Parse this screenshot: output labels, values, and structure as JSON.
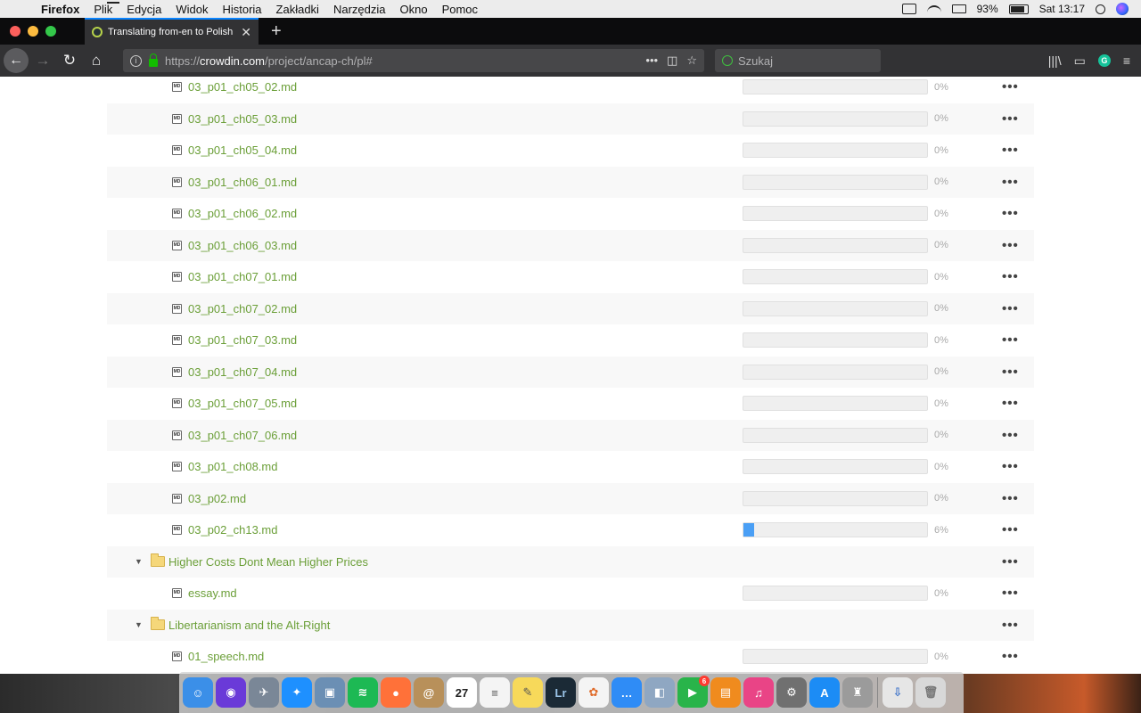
{
  "menubar": {
    "app": "Firefox",
    "items": [
      "Plik",
      "Edycja",
      "Widok",
      "Historia",
      "Zakładki",
      "Narzędzia",
      "Okno",
      "Pomoc"
    ],
    "battery": "93%",
    "clock": "Sat 13:17"
  },
  "tabs": [
    {
      "title": "Translating from-en to Polish la"
    }
  ],
  "navbar": {
    "url_prefix": "https://",
    "url_host": "crowdin.com",
    "url_path": "/project/ancap-ch/pl#",
    "search_placeholder": "Szukaj",
    "icons": [
      "back-icon",
      "forward-icon",
      "reload-icon",
      "home-icon",
      "info-icon",
      "lock-icon",
      "page-actions-icon",
      "pocket-icon",
      "bookmark-star-icon",
      "library-icon",
      "sidebar-icon",
      "grammarly-icon",
      "menu-icon"
    ]
  },
  "rows": [
    {
      "type": "file",
      "name": "03_p01_ch05_02.md",
      "progress": 0,
      "pct": "0%"
    },
    {
      "type": "file",
      "name": "03_p01_ch05_03.md",
      "progress": 0,
      "pct": "0%"
    },
    {
      "type": "file",
      "name": "03_p01_ch05_04.md",
      "progress": 0,
      "pct": "0%"
    },
    {
      "type": "file",
      "name": "03_p01_ch06_01.md",
      "progress": 0,
      "pct": "0%"
    },
    {
      "type": "file",
      "name": "03_p01_ch06_02.md",
      "progress": 0,
      "pct": "0%"
    },
    {
      "type": "file",
      "name": "03_p01_ch06_03.md",
      "progress": 0,
      "pct": "0%"
    },
    {
      "type": "file",
      "name": "03_p01_ch07_01.md",
      "progress": 0,
      "pct": "0%"
    },
    {
      "type": "file",
      "name": "03_p01_ch07_02.md",
      "progress": 0,
      "pct": "0%"
    },
    {
      "type": "file",
      "name": "03_p01_ch07_03.md",
      "progress": 0,
      "pct": "0%"
    },
    {
      "type": "file",
      "name": "03_p01_ch07_04.md",
      "progress": 0,
      "pct": "0%"
    },
    {
      "type": "file",
      "name": "03_p01_ch07_05.md",
      "progress": 0,
      "pct": "0%"
    },
    {
      "type": "file",
      "name": "03_p01_ch07_06.md",
      "progress": 0,
      "pct": "0%"
    },
    {
      "type": "file",
      "name": "03_p01_ch08.md",
      "progress": 0,
      "pct": "0%"
    },
    {
      "type": "file",
      "name": "03_p02.md",
      "progress": 0,
      "pct": "0%"
    },
    {
      "type": "file",
      "name": "03_p02_ch13.md",
      "progress": 6,
      "pct": "6%"
    },
    {
      "type": "folder",
      "name": "Higher Costs Dont Mean Higher Prices"
    },
    {
      "type": "file",
      "name": "essay.md",
      "progress": 0,
      "pct": "0%"
    },
    {
      "type": "folder",
      "name": "Libertarianism and the Alt-Right"
    },
    {
      "type": "file",
      "name": "01_speech.md",
      "progress": 0,
      "pct": "0%"
    }
  ],
  "more_label": "•••",
  "file_icon_label": "MD",
  "dock": {
    "apps": [
      {
        "name": "finder",
        "color": "#3b8fe8",
        "glyph": "☺"
      },
      {
        "name": "siri",
        "color": "#6a3ad8",
        "glyph": "◉"
      },
      {
        "name": "launchpad",
        "color": "#7a8797",
        "glyph": "✈"
      },
      {
        "name": "safari",
        "color": "#1e90ff",
        "glyph": "✦"
      },
      {
        "name": "preview",
        "color": "#6b8fb4",
        "glyph": "▣"
      },
      {
        "name": "spotify",
        "color": "#1db954",
        "glyph": "≋"
      },
      {
        "name": "firefox",
        "color": "#ff7139",
        "glyph": "●"
      },
      {
        "name": "contacts",
        "color": "#b8905a",
        "glyph": "@"
      },
      {
        "name": "calendar",
        "color": "#ffffff",
        "glyph": "27",
        "text": "#222"
      },
      {
        "name": "reminders",
        "color": "#f4f4f4",
        "glyph": "≡",
        "text": "#555"
      },
      {
        "name": "notes",
        "color": "#f7d95a",
        "glyph": "✎",
        "text": "#555"
      },
      {
        "name": "lightroom",
        "color": "#1b2a36",
        "glyph": "Lr",
        "text": "#9bc4e8"
      },
      {
        "name": "photos",
        "color": "#f4f4f4",
        "glyph": "✿",
        "text": "#e06c2b"
      },
      {
        "name": "messages",
        "color": "#2f8cf6",
        "glyph": "…"
      },
      {
        "name": "image-capture",
        "color": "#8fa7c2",
        "glyph": "◧"
      },
      {
        "name": "facetime",
        "color": "#29b44a",
        "glyph": "▶",
        "badge": "6"
      },
      {
        "name": "ibooks",
        "color": "#f08b1e",
        "glyph": "▤"
      },
      {
        "name": "itunes",
        "color": "#e94486",
        "glyph": "♫"
      },
      {
        "name": "system-preferences",
        "color": "#707070",
        "glyph": "⚙"
      },
      {
        "name": "app-store",
        "color": "#1c8cf5",
        "glyph": "A"
      },
      {
        "name": "automator",
        "color": "#9b9b9b",
        "glyph": "♜"
      },
      {
        "sep": true
      },
      {
        "name": "downloads",
        "color": "#e6e6e6",
        "glyph": "⇩",
        "text": "#3a70c8"
      },
      {
        "name": "trash",
        "color": "#d8d8d8",
        "glyph": "🗑",
        "text": "#777"
      }
    ]
  }
}
